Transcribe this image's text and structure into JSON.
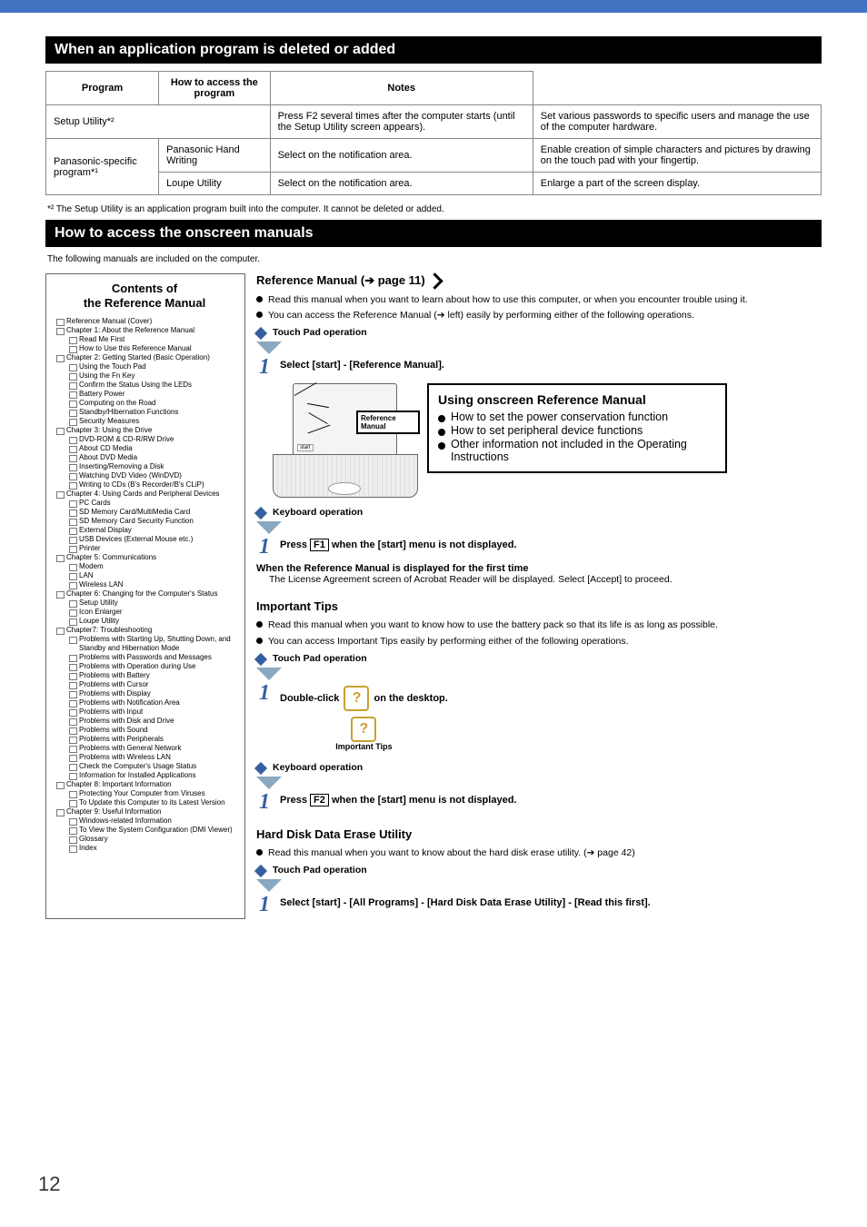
{
  "page_number": "12",
  "black_bar_title": "When an application program is deleted or added",
  "table": {
    "headers": [
      "Program",
      "How to access the program",
      "Notes"
    ],
    "rows": [
      [
        "Setup Utility*²",
        "Press F2 several times after the computer starts (until the Setup Utility screen appears).",
        "Set various passwords to specific users and manage the use of the computer hardware."
      ],
      [
        "Panasonic Hand Writing",
        "Select  on the notification area.",
        "Enable creation of simple characters and pictures by drawing on the touch pad with your fingertip."
      ],
      [
        "Loupe Utility",
        "Select  on the notification area.",
        "Enlarge a part of the screen display."
      ]
    ],
    "footnote": "*² The Setup Utility is an application program built into the computer. It cannot be deleted or added."
  },
  "black_bar_manuals": "How to access the onscreen manuals",
  "note_after_manuals": "The following manuals are included on the computer.",
  "toc_title": "Contents of\nthe Reference Manual",
  "toc": [
    "Reference Manual (Cover)",
    "Chapter 1: About the Reference Manual",
    "Read Me First",
    "How to Use this Reference Manual",
    "Chapter 2: Getting Started (Basic Operation)",
    "Using the Touch Pad",
    "Using the Fn Key",
    "Confirm the Status Using the LEDs",
    "Battery Power",
    "Computing on the Road",
    "Standby/Hibernation Functions",
    "Security Measures",
    "Chapter 3: Using the Drive",
    "DVD-ROM & CD-R/RW Drive",
    "About CD Media",
    "About DVD Media",
    "Inserting/Removing a Disk",
    "Watching DVD Video (WinDVD)",
    "Writing to CDs (B's Recorder/B's CLiP)",
    "Chapter 4: Using Cards and Peripheral Devices",
    "PC Cards",
    "SD Memory Card/MultiMedia Card",
    "SD Memory Card Security Function",
    "External Display",
    "USB Devices (External Mouse etc.)",
    "Printer",
    "Chapter 5: Communications",
    "Modem",
    "LAN",
    "Wireless LAN",
    "Chapter 6: Changing for the Computer's Status",
    "Setup Utility",
    "Icon Enlarger",
    "Loupe Utility",
    "Chapter7: Troubleshooting",
    "Problems with Starting Up, Shutting Down, and Standby and Hibernation Mode",
    "Problems with Passwords and Messages",
    "Problems with Operation during Use",
    "Problems with Battery",
    "Problems with Cursor",
    "Problems with Display",
    "Problems with Notification Area",
    "Problems with Input",
    "Problems with Disk and Drive",
    "Problems with Sound",
    "Problems with Peripherals",
    "Problems with General Network",
    "Problems with Wireless LAN",
    "Check the Computer's Usage Status",
    "Information for Installed Applications",
    "Chapter 8: Important Information",
    "Protecting Your Computer from Viruses",
    "To Update this Computer to its Latest Version",
    "Chapter 9: Useful Information",
    "Windows-related Information",
    "To View the System Configuration (DMI Viewer)",
    "Glossary",
    "Index"
  ],
  "guides": {
    "ref_manual": {
      "title": "Reference Manual (➔ page 11)",
      "b1": "Read this manual when you want to learn about how to use this computer, or when you encounter trouble using it.",
      "b2": "You can access the Reference Manual (➔ left) easily by performing either of the following operations.",
      "t_title": "Touch Pad operation",
      "t1": "Select [start] - [Reference Manual].",
      "k_title": "Keyboard operation",
      "k1_pre": "Press ",
      "k1_key": "F1",
      "k1_post": " when the [start] menu is not displayed.",
      "disp_title": "When the Reference Manual is displayed for the first time",
      "disp1": "The License Agreement screen of Acrobat Reader will be displayed. Select [Accept] to proceed.",
      "laptop_label_start": "start",
      "laptop_label_ref": "Reference Manual",
      "callout": {
        "h": "Using onscreen Reference Manual",
        "r1": "How to set the power conservation function",
        "r2": "How to set peripheral device functions",
        "r3": "Other information not included in the Operating Instructions"
      }
    },
    "tips": {
      "title": "Important Tips",
      "b1": "Read this manual when you want to know how to use the battery pack so that its life is as long as possible.",
      "b2": "You can access Important Tips easily by performing either of the following operations.",
      "t_title": "Touch Pad operation",
      "t1_pre": "Double-click ",
      "t1_post": " on the desktop.",
      "icon_label": "Important Tips",
      "k_title": "Keyboard operation",
      "k1_pre": "Press ",
      "k1_key": "F2",
      "k1_post": "when the [start] menu is not displayed."
    },
    "hdd": {
      "title": "Hard Disk Data Erase Utility",
      "b1": "Read this manual when you want to know about the hard disk erase utility.  (➔ page 42)",
      "t_title": "Touch Pad operation",
      "t1": "Select [start] - [All Programs] - [Hard Disk Data Erase Utility] - [Read this first]."
    }
  }
}
